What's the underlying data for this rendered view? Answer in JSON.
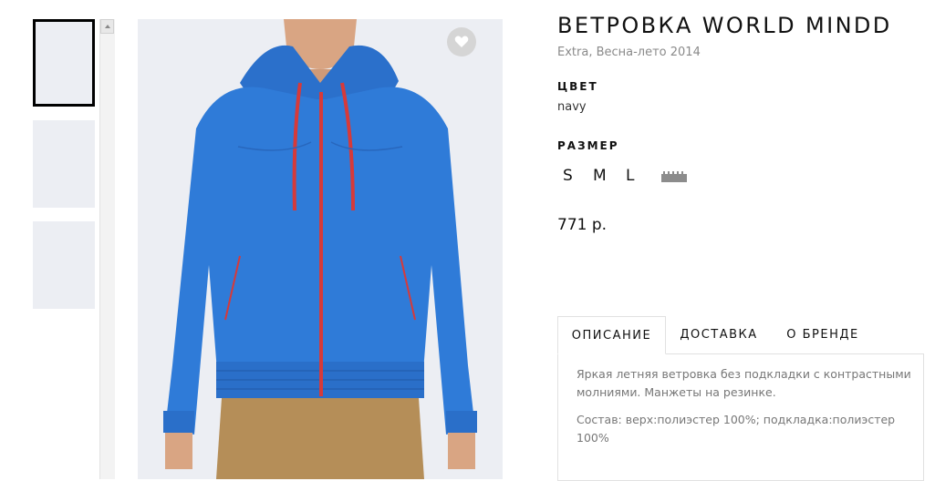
{
  "product": {
    "title": "ВЕТРОВКА WORLD MINDD",
    "subtitle": "Extra, Весна-лето 2014",
    "color_heading": "ЦВЕТ",
    "color_value": "navy",
    "size_heading": "РАЗМЕР",
    "sizes": [
      "S",
      "M",
      "L"
    ],
    "price": "771 р.",
    "ruler_icon": "ruler-icon"
  },
  "gallery": {
    "selected_index": 0,
    "jacket_color": "#2f7bd8",
    "zipper_color": "#d63a3a",
    "pants_color": "#b58e58",
    "background": "#eceef3"
  },
  "tabs": [
    "ОПИСАНИЕ",
    "ДОСТАВКА",
    "О БРЕНДЕ"
  ],
  "description": {
    "text1": "Яркая летняя ветровка без подкладки с контрастными молниями. Манжеты на резинке.",
    "text2": "Состав: верх:полиэстер 100%; подкладка:полиэстер 100%"
  }
}
